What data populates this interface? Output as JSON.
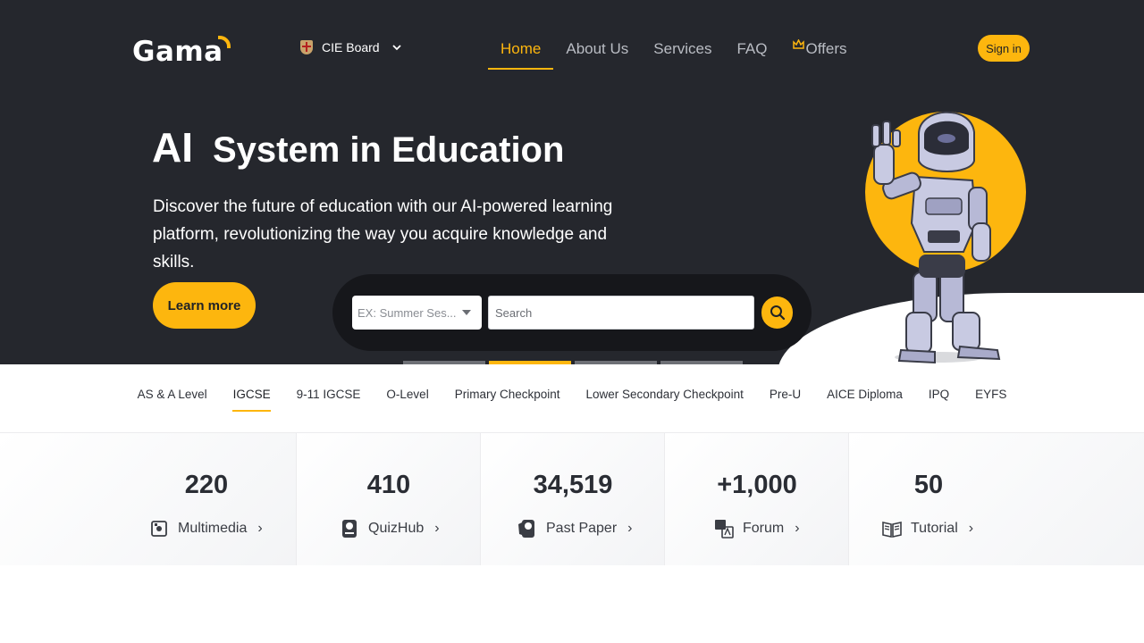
{
  "header": {
    "logo_text": "Gama",
    "board_label": "CIE Board",
    "nav": [
      {
        "label": "Home",
        "active": true
      },
      {
        "label": "About Us",
        "active": false
      },
      {
        "label": "Services",
        "active": false
      },
      {
        "label": "FAQ",
        "active": false
      },
      {
        "label": "Offers",
        "active": false
      }
    ],
    "signin_label": "Sign in"
  },
  "hero": {
    "title_ai": "AI",
    "title_rest": "System in Education",
    "description": "Discover the future of education with our AI-powered learning platform, revolutionizing the way you acquire knowledge and skills.",
    "cta_label": "Learn more"
  },
  "search": {
    "session_placeholder": "EX: Summer Ses...",
    "search_placeholder": "Search"
  },
  "carousel": {
    "slides": 4,
    "active_index": 1
  },
  "tabs": [
    {
      "label": "AS & A Level",
      "active": false
    },
    {
      "label": "IGCSE",
      "active": true
    },
    {
      "label": "9-11 IGCSE",
      "active": false
    },
    {
      "label": "O-Level",
      "active": false
    },
    {
      "label": "Primary Checkpoint",
      "active": false
    },
    {
      "label": "Lower Secondary Checkpoint",
      "active": false
    },
    {
      "label": "Pre-U",
      "active": false
    },
    {
      "label": "AICE Diploma",
      "active": false
    },
    {
      "label": "IPQ",
      "active": false
    },
    {
      "label": "EYFS",
      "active": false
    }
  ],
  "stats": [
    {
      "value": "220",
      "label": "Multimedia",
      "icon": "multimedia-icon"
    },
    {
      "value": "410",
      "label": "QuizHub",
      "icon": "quizhub-icon"
    },
    {
      "value": "34,519",
      "label": "Past Paper",
      "icon": "past-paper-icon"
    },
    {
      "value": "+1,000",
      "label": "Forum",
      "icon": "forum-icon"
    },
    {
      "value": "50",
      "label": "Tutorial",
      "icon": "tutorial-icon"
    }
  ],
  "colors": {
    "accent": "#fdb60e",
    "hero_bg": "#25272d",
    "search_bar_bg": "#16171b",
    "nav_text": "#b9bcc3"
  }
}
